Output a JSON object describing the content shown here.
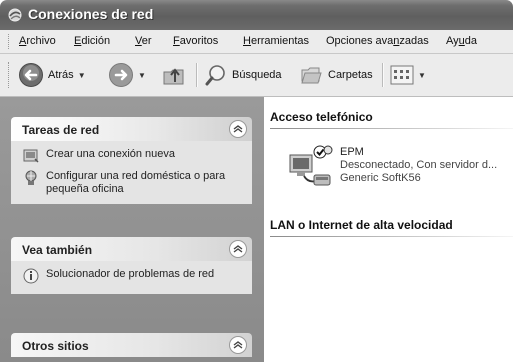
{
  "window": {
    "title": "Conexiones de red"
  },
  "menu": [
    {
      "pre": "",
      "u": "A",
      "post": "rchivo"
    },
    {
      "pre": "",
      "u": "E",
      "post": "dición"
    },
    {
      "pre": "",
      "u": "V",
      "post": "er"
    },
    {
      "pre": "",
      "u": "F",
      "post": "avoritos"
    },
    {
      "pre": "",
      "u": "H",
      "post": "erramientas"
    },
    {
      "pre": "Opciones ava",
      "u": "n",
      "post": "zadas"
    },
    {
      "pre": "Ay",
      "u": "u",
      "post": "da"
    }
  ],
  "toolbar": {
    "back_label": "Atrás",
    "search_label": "Búsqueda",
    "folders_label": "Carpetas"
  },
  "left": {
    "network_tasks": {
      "title": "Tareas de red",
      "items": [
        "Crear una conexión nueva",
        "Configurar una red doméstica o para pequeña oficina"
      ]
    },
    "see_also": {
      "title": "Vea también",
      "items": [
        "Solucionador de problemas de red"
      ]
    },
    "other_places": {
      "title": "Otros sitios"
    }
  },
  "right": {
    "dialup": {
      "header": "Acceso telefónico",
      "connection": {
        "name": "EPM",
        "status": "Desconectado, Con servidor d...",
        "device": "Generic SoftK56"
      }
    },
    "lan": {
      "header": "LAN o Internet de alta velocidad"
    }
  }
}
